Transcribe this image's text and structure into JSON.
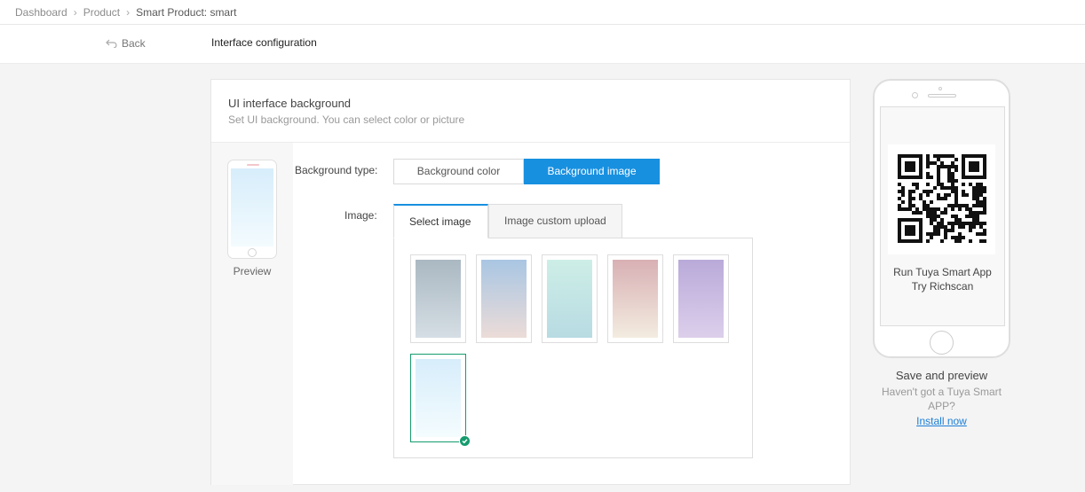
{
  "breadcrumb": [
    {
      "label": "Dashboard"
    },
    {
      "label": "Product"
    },
    {
      "label": "Smart Product: smart"
    }
  ],
  "header": {
    "back_label": "Back",
    "title": "Interface configuration"
  },
  "panel": {
    "title": "UI interface background",
    "subtitle": "Set UI background. You can select color or picture",
    "preview_label": "Preview",
    "background_type_label": "Background type:",
    "background_options": [
      {
        "label": "Background color",
        "active": false
      },
      {
        "label": "Background image",
        "active": true
      }
    ],
    "image_label": "Image:",
    "image_tabs": [
      {
        "label": "Select image",
        "active": true
      },
      {
        "label": "Image custom upload",
        "active": false
      }
    ],
    "thumbnails": [
      {
        "colors": [
          "#aab8c2",
          "#d5dee4"
        ],
        "selected": false
      },
      {
        "colors": [
          "#a9c6e3",
          "#ecdcd8"
        ],
        "selected": false
      },
      {
        "colors": [
          "#cdeee6",
          "#b8dbe3"
        ],
        "selected": false
      },
      {
        "colors": [
          "#d8b0b4",
          "#f3ece0"
        ],
        "selected": false
      },
      {
        "colors": [
          "#b9aad9",
          "#dccfeb"
        ],
        "selected": false
      },
      {
        "colors": [
          "#d7edfb",
          "#f4fcfe"
        ],
        "selected": true
      }
    ]
  },
  "phone_preview": {
    "scan_text_line1": "Run Tuya Smart App",
    "scan_text_line2": "Try Richscan",
    "save_title": "Save and preview",
    "save_sub": "Haven't got a Tuya Smart APP?",
    "install_link": "Install now"
  },
  "colors": {
    "accent": "#1890e0",
    "selected": "#159b6e"
  }
}
